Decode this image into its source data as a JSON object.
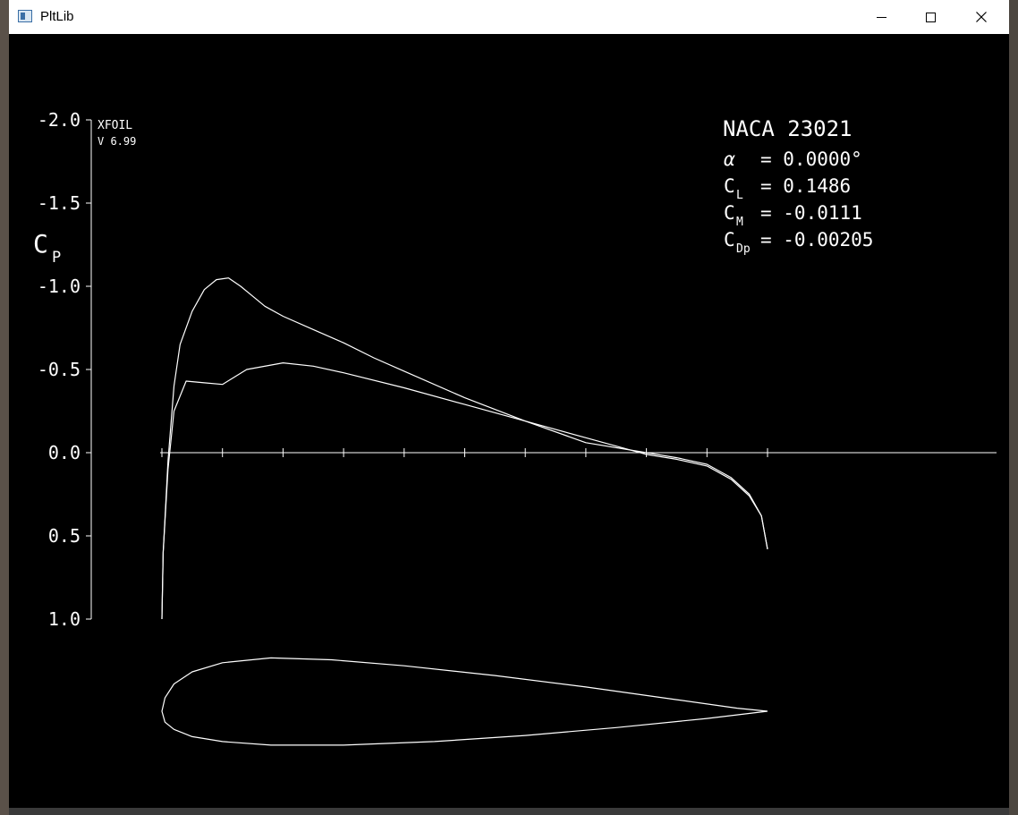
{
  "window": {
    "title": "PltLib",
    "icon": "app-window-icon",
    "controls": {
      "minimize": "minimize-icon",
      "maximize": "maximize-icon",
      "close": "close-icon"
    }
  },
  "plot": {
    "program": "XFOIL",
    "version": "V 6.99",
    "airfoil": "NACA 23021",
    "alpha_label": "α",
    "alpha_value": "=  0.0000°",
    "cl_main": "C",
    "cl_sub": "L",
    "cl_value": "=  0.1486",
    "cm_main": "C",
    "cm_sub": "M",
    "cm_value": "= -0.0111",
    "cdp_main": "C",
    "cdp_sub": "Dp",
    "cdp_value": "= -0.00205",
    "y_label_main": "C",
    "y_label_sub": "P",
    "foreground": "#ffffff",
    "background": "#000000"
  },
  "chart_data": {
    "type": "line",
    "title": "NACA 23021",
    "xlabel": "",
    "ylabel": "Cp",
    "ylim": [
      1.0,
      -2.0
    ],
    "xlim": [
      0,
      1
    ],
    "y_inverted": true,
    "y_ticks": [
      "-2.0",
      "-1.5",
      "-1.0",
      "-0.5",
      "0.0",
      "0.5",
      "1.0"
    ],
    "y_tick_values": [
      -2.0,
      -1.5,
      -1.0,
      -0.5,
      0.0,
      0.5,
      1.0
    ],
    "x_tick_values": [
      0.0,
      0.1,
      0.2,
      0.3,
      0.4,
      0.5,
      0.6,
      0.7,
      0.8,
      0.9,
      1.0
    ],
    "grid": false,
    "series": [
      {
        "x": [
          0.0,
          0.002,
          0.01,
          0.02,
          0.03,
          0.05,
          0.07,
          0.09,
          0.11,
          0.13,
          0.15,
          0.17,
          0.2,
          0.25,
          0.3,
          0.35,
          0.4,
          0.5,
          0.6,
          0.7,
          0.8,
          0.85,
          0.9,
          0.94,
          0.97,
          0.99,
          1.0
        ],
        "y": [
          1.0,
          0.6,
          0.05,
          -0.4,
          -0.65,
          -0.85,
          -0.98,
          -1.04,
          -1.05,
          -1.0,
          -0.94,
          -0.88,
          -0.82,
          -0.74,
          -0.66,
          -0.57,
          -0.49,
          -0.33,
          -0.19,
          -0.06,
          0.0,
          0.03,
          0.07,
          0.15,
          0.25,
          0.38,
          0.58
        ]
      },
      {
        "x": [
          0.0,
          0.002,
          0.01,
          0.02,
          0.04,
          0.07,
          0.1,
          0.14,
          0.2,
          0.25,
          0.3,
          0.4,
          0.5,
          0.6,
          0.7,
          0.8,
          0.85,
          0.9,
          0.94,
          0.97,
          0.99,
          1.0
        ],
        "y": [
          1.0,
          0.6,
          0.1,
          -0.25,
          -0.43,
          -0.42,
          -0.41,
          -0.5,
          -0.54,
          -0.52,
          -0.48,
          -0.39,
          -0.29,
          -0.19,
          -0.09,
          0.01,
          0.04,
          0.08,
          0.16,
          0.26,
          0.38,
          0.58
        ]
      }
    ],
    "airfoil_outline": {
      "x": [
        1.0,
        0.95,
        0.85,
        0.7,
        0.55,
        0.4,
        0.28,
        0.18,
        0.1,
        0.05,
        0.02,
        0.005,
        0.0,
        0.005,
        0.02,
        0.05,
        0.1,
        0.18,
        0.3,
        0.45,
        0.6,
        0.75,
        0.9,
        1.0
      ],
      "y": [
        0.0,
        0.005,
        0.019,
        0.04,
        0.059,
        0.075,
        0.085,
        0.088,
        0.08,
        0.065,
        0.045,
        0.022,
        0.0,
        -0.018,
        -0.03,
        -0.042,
        -0.05,
        -0.056,
        -0.056,
        -0.05,
        -0.04,
        -0.027,
        -0.012,
        0.0
      ]
    }
  }
}
